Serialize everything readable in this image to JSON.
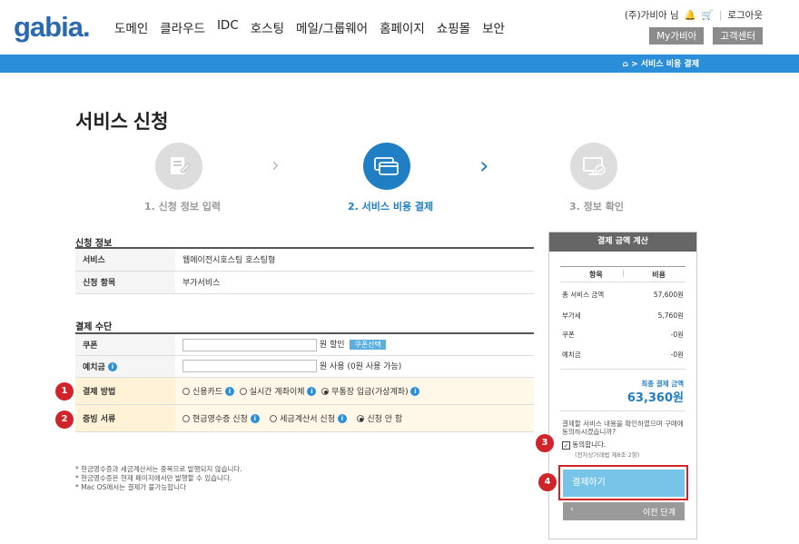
{
  "header": {
    "logo": "gabia.",
    "nav": [
      "도메인",
      "클라우드",
      "IDC",
      "호스팅",
      "메일/그룹웨어",
      "홈페이지",
      "쇼핑몰",
      "보안"
    ],
    "user": "(주)가비아 님",
    "logout": "로그아웃",
    "my_gabia": "My가비아",
    "support": "고객센터",
    "breadcrumb": "> 서비스 비용 결제"
  },
  "page_title": "서비스 신청",
  "steps": [
    {
      "label": "1. 신청 정보 입력",
      "state": "done"
    },
    {
      "label": "2. 서비스 비용 결제",
      "state": "active"
    },
    {
      "label": "3. 정보 확인",
      "state": "todo"
    }
  ],
  "apply_info": {
    "title": "신청 정보",
    "rows": [
      {
        "th": "서비스",
        "td": "웹에이전시호스팅 호스팅형"
      },
      {
        "th": "신청 항목",
        "td": "부가서비스"
      }
    ]
  },
  "payment": {
    "title": "결제 수단",
    "coupon_label": "쿠폰",
    "coupon_suffix": "원 할인",
    "coupon_btn": "쿠폰선택",
    "deposit_label": "예치금",
    "deposit_suffix": "원 사용 (0원 사용 가능)",
    "method_label": "결제 방법",
    "methods": [
      "신용카드",
      "실시간 계좌이체",
      "무통장 입금(가상계좌)"
    ],
    "receipt_label": "증빙 서류",
    "receipts": [
      "현금영수증 신청",
      "세금계산서 신청",
      "신청 안 함"
    ]
  },
  "badges": [
    "1",
    "2",
    "3",
    "4"
  ],
  "notes": [
    "* 현금영수증과 세금계산서는 중복으로 발행되지 않습니다.",
    "* 현금영수증은 현재 페이지에서만 발행할 수 있습니다.",
    "* Mac OS에서는 결제가 불가능합니다"
  ],
  "summary": {
    "title": "결제 금액 계산",
    "col_item": "항목",
    "col_cost": "비용",
    "rows": [
      {
        "k": "총 서비스 금액",
        "v": "57,600원"
      },
      {
        "k": "부가세",
        "v": "5,760원"
      },
      {
        "k": "쿠폰",
        "v": "-0원"
      },
      {
        "k": "예치금",
        "v": "-0원"
      }
    ],
    "final_label": "최종 결제 금액",
    "final_value": "63,360원",
    "agree_q": "결제할 서비스 내용을 확인하였으며 구매에 동의하시겠습니까?",
    "agree_label": "동의합니다.",
    "agree_note": "(전자상거래법 제8조 2항)",
    "pay_btn": "결제하기",
    "prev_btn": "이전 단계"
  }
}
